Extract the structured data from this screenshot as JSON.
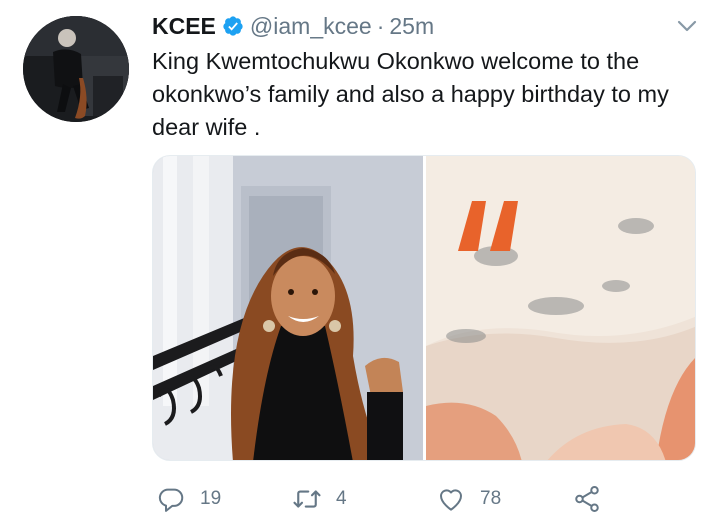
{
  "tweet": {
    "author": {
      "display_name": "KCEE",
      "verified": true,
      "handle": "@iam_kcee",
      "avatar_icon": "profile-photo"
    },
    "separator": "·",
    "timestamp": "25m",
    "text": "King Kwemtochukwu Okonkwo welcome to the okonkwo’s family and also a happy birthday to my dear wife .",
    "media": [
      {
        "description_icon": "photo-woman-portrait"
      },
      {
        "description_icon": "photo-baby-blanket-quote"
      }
    ],
    "actions": {
      "reply": {
        "count": "19",
        "icon": "reply-icon"
      },
      "retweet": {
        "count": "4",
        "icon": "retweet-icon"
      },
      "like": {
        "count": "78",
        "icon": "heart-icon"
      },
      "share": {
        "icon": "share-icon"
      }
    },
    "colors": {
      "text": "#14171a",
      "secondary": "#657786",
      "verified": "#1da1f2",
      "quote_mark": "#e8632b"
    }
  }
}
